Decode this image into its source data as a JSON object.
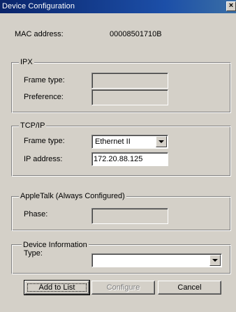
{
  "window": {
    "title": "Device Configuration",
    "close_glyph": "×"
  },
  "mac": {
    "label": "MAC address:",
    "value": "00008501710B"
  },
  "ipx": {
    "legend": "IPX",
    "frame_type_label": "Frame type:",
    "frame_type_value": "",
    "preference_label": "Preference:",
    "preference_value": ""
  },
  "tcpip": {
    "legend": "TCP/IP",
    "frame_type_label": "Frame type:",
    "frame_type_value": "Ethernet II",
    "ip_label": "IP address:",
    "ip_value": "172.20.88.125"
  },
  "appletalk": {
    "legend": "AppleTalk (Always Configured)",
    "phase_label": "Phase:",
    "phase_value": ""
  },
  "device_info": {
    "legend": "Device Information",
    "type_label": "Type:",
    "type_value": ""
  },
  "buttons": {
    "add_to_list": "Add to List",
    "configure": "Configure",
    "cancel": "Cancel"
  },
  "icons": {
    "close": "close-icon",
    "dropdown": "chevron-down-icon"
  }
}
